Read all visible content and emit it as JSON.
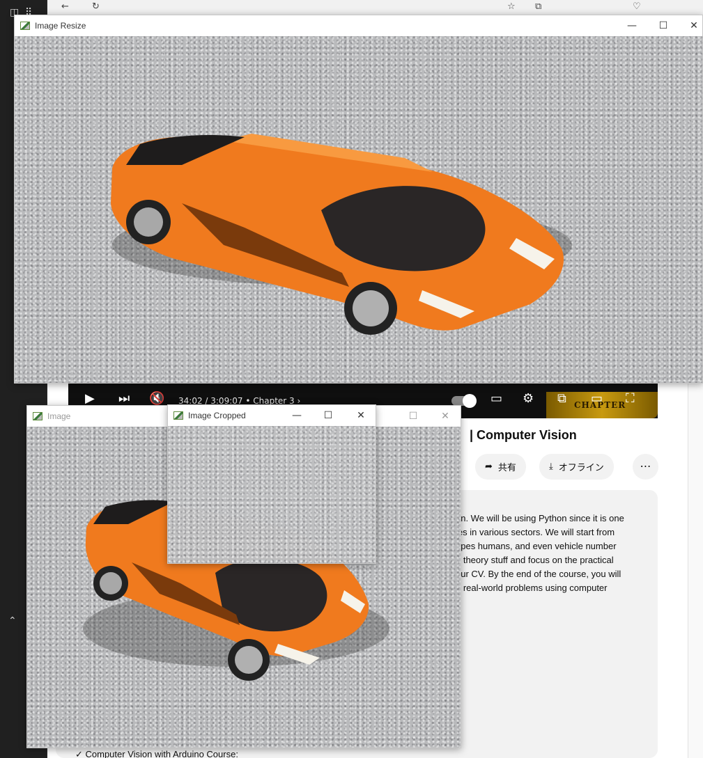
{
  "windows": {
    "resize": {
      "title": "Image Resize",
      "minimize": "—",
      "maximize": "☐",
      "close": "✕"
    },
    "image": {
      "title": "Image",
      "minimize": "—",
      "maximize": "☐",
      "close": "✕"
    },
    "cropped": {
      "title": "Image Cropped",
      "minimize": "—",
      "maximize": "☐",
      "close": "✕"
    }
  },
  "player": {
    "time": "34:02 / 3:09:07",
    "chapter": "•  Chapter 3  ›",
    "progress_fraction": 0.18,
    "chapter_thumb_text": "CHAPTER",
    "icons": [
      "play-icon",
      "next-icon",
      "mute-icon",
      "autoplay-toggle",
      "subtitles-icon",
      "settings-icon",
      "miniplayer-icon",
      "theater-icon",
      "fullscreen-icon"
    ]
  },
  "video": {
    "title": "| Computer Vision",
    "share_label": "共有",
    "offline_label": "オフライン",
    "more_label": "⋯"
  },
  "description": {
    "lines": [
      "on. We will be using Python since it is one",
      "ies in various sectors. We will start from",
      "apes humans, and even vehicle number",
      "g theory stuff and focus on the practical",
      "our CV. By the end of the course, you will",
      "e real-world problems using computer"
    ],
    "footer": "✓ Computer Vision with Arduino Course:"
  },
  "colors": {
    "car_body": "#f07a1e",
    "car_shade": "#c85a10",
    "carpet": "#b9babc",
    "progress": "#ff0033"
  }
}
